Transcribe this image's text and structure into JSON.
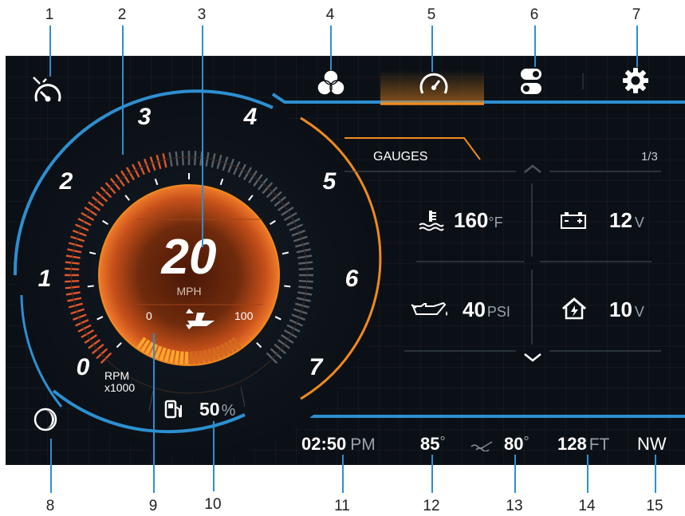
{
  "callouts": [
    "1",
    "2",
    "3",
    "4",
    "5",
    "6",
    "7",
    "8",
    "9",
    "10",
    "11",
    "12",
    "13",
    "14",
    "15"
  ],
  "colors": {
    "accent_blue": "#2d8fd0",
    "accent_orange": "#f08a1e",
    "screen_bg": "#0b1016"
  },
  "toolbar": {
    "items": [
      {
        "icon": "performance-gauge-icon"
      },
      {
        "icon": "color-mixer-icon"
      },
      {
        "icon": "speedometer-icon",
        "active": true
      },
      {
        "icon": "toggle-switches-icon"
      },
      {
        "icon": "gear-icon"
      }
    ]
  },
  "tachometer": {
    "rpm_labels": [
      "0",
      "1",
      "2",
      "3",
      "4",
      "5",
      "6",
      "7"
    ],
    "unit_line1": "RPM",
    "unit_line2": "x1000"
  },
  "speed": {
    "value": "20",
    "unit": "MPH"
  },
  "trim": {
    "min": "0",
    "max": "100"
  },
  "fuel": {
    "value": "50",
    "unit": "%",
    "level": 0.5
  },
  "gauges_panel": {
    "title": "GAUGES",
    "page": "1/3",
    "items": [
      {
        "icon": "engine-temperature-icon",
        "value": "160",
        "unit": "°F"
      },
      {
        "icon": "battery-icon",
        "value": "12",
        "unit": "V"
      },
      {
        "icon": "oil-pressure-icon",
        "value": "40",
        "unit": "PSI"
      },
      {
        "icon": "house-battery-icon",
        "value": "10",
        "unit": "V"
      }
    ]
  },
  "status_bar": {
    "time": "02:50",
    "ampm": "PM",
    "air_temp": "85",
    "air_unit": "°",
    "water_temp": "80",
    "water_unit": "°",
    "depth": "128",
    "depth_unit": "FT",
    "heading": "NW"
  }
}
